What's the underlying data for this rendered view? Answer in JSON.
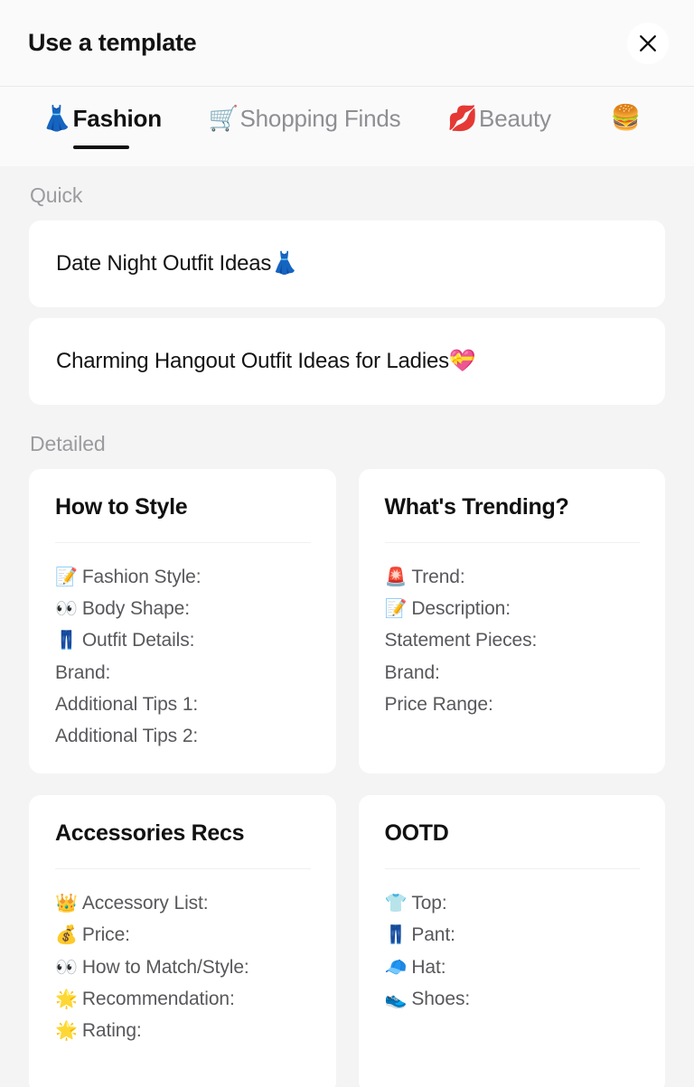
{
  "header": {
    "title": "Use a template",
    "close_label": "×"
  },
  "tabs": [
    {
      "emoji": "👗",
      "label": "Fashion",
      "active": true
    },
    {
      "emoji": "🛒",
      "label": "Shopping Finds",
      "active": false
    },
    {
      "emoji": "💋",
      "label": "Beauty",
      "active": false
    },
    {
      "emoji": "🍔",
      "label": "",
      "active": false
    }
  ],
  "sections": {
    "quick_label": "Quick",
    "detailed_label": "Detailed"
  },
  "quick_templates": [
    {
      "text": "Date Night Outfit Ideas👗"
    },
    {
      "text": "Charming Hangout Outfit Ideas for Ladies💝"
    }
  ],
  "detailed_templates": [
    {
      "title": "How to Style",
      "fields": [
        {
          "emoji": "📝",
          "label": "Fashion Style:"
        },
        {
          "emoji": "👀",
          "label": "Body Shape:"
        },
        {
          "emoji": "👖",
          "label": "Outfit Details:"
        },
        {
          "emoji": "",
          "label": "Brand:"
        },
        {
          "emoji": "",
          "label": "Additional Tips 1:"
        },
        {
          "emoji": "",
          "label": "Additional Tips 2:"
        }
      ]
    },
    {
      "title": "What's Trending?",
      "fields": [
        {
          "emoji": "🚨",
          "label": "Trend:"
        },
        {
          "emoji": "📝",
          "label": "Description:"
        },
        {
          "emoji": "",
          "label": "Statement Pieces:"
        },
        {
          "emoji": "",
          "label": "Brand:"
        },
        {
          "emoji": "",
          "label": "Price Range:"
        }
      ]
    },
    {
      "title": "Accessories Recs",
      "fields": [
        {
          "emoji": "👑",
          "label": "Accessory List:"
        },
        {
          "emoji": "💰",
          "label": "Price:"
        },
        {
          "emoji": "👀",
          "label": "How to Match/Style:"
        },
        {
          "emoji": "🌟",
          "label": "Recommendation:"
        },
        {
          "emoji": "🌟",
          "label": "Rating:"
        }
      ]
    },
    {
      "title": "OOTD",
      "fields": [
        {
          "emoji": "👕",
          "label": "Top:"
        },
        {
          "emoji": "👖",
          "label": "Pant:"
        },
        {
          "emoji": "🧢",
          "label": "Hat:"
        },
        {
          "emoji": "👟",
          "label": "Shoes:"
        }
      ]
    }
  ],
  "colors": {
    "page_background": "#f4f4f5",
    "card_background": "#ffffff",
    "accent_underline": "#111111",
    "muted_text": "#9b9b9f",
    "field_text": "#58585c"
  }
}
